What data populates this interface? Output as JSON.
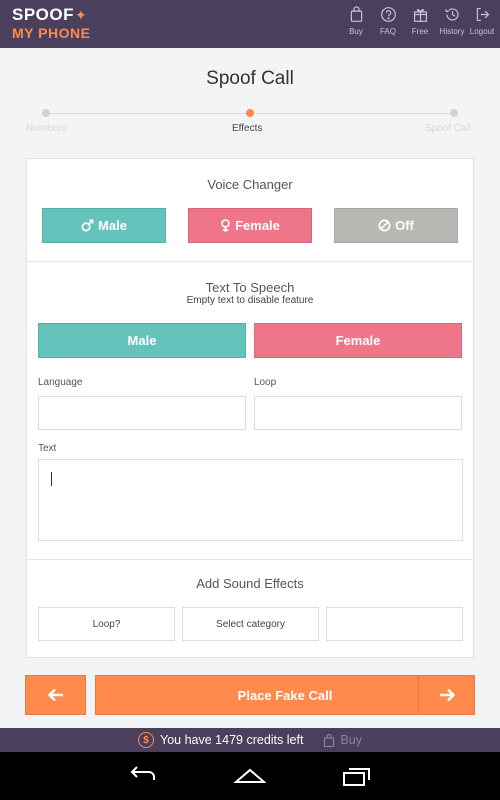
{
  "app": {
    "logo_line1": "SPOOF",
    "logo_line2": "MY PHONE",
    "nav": [
      {
        "label": "Buy",
        "icon": "bag-icon"
      },
      {
        "label": "FAQ",
        "icon": "question-icon"
      },
      {
        "label": "Free",
        "icon": "gift-icon"
      },
      {
        "label": "History",
        "icon": "history-icon"
      },
      {
        "label": "Logout",
        "icon": "logout-icon"
      }
    ]
  },
  "page": {
    "title": "Spoof Call",
    "steps": [
      {
        "label": "Numbers",
        "active": false
      },
      {
        "label": "Effects",
        "active": true
      },
      {
        "label": "Spoof Call",
        "active": false
      }
    ]
  },
  "voice_changer": {
    "title": "Voice Changer",
    "male_label": "Male",
    "female_label": "Female",
    "off_label": "Off"
  },
  "tts": {
    "title": "Text To Speech",
    "subtitle": "Empty text to disable feature",
    "male_label": "Male",
    "female_label": "Female",
    "language_label": "Language",
    "language_value": "",
    "loop_label": "Loop",
    "loop_value": "",
    "text_label": "Text",
    "text_value": ""
  },
  "sound_effects": {
    "title": "Add Sound Effects",
    "loop_option": "Loop?",
    "category_option": "Select category",
    "sound_option": ""
  },
  "actions": {
    "back_icon": "arrow-left-icon",
    "place_call_label": "Place Fake Call",
    "next_icon": "arrow-right-icon"
  },
  "credits": {
    "text": "You have 1479 credits left",
    "buy_label": "Buy"
  },
  "colors": {
    "header": "#4a3f5c",
    "accent": "#ff8a4c",
    "teal": "#64c4bb",
    "pink": "#ef7688",
    "grey": "#b8b8b5"
  }
}
